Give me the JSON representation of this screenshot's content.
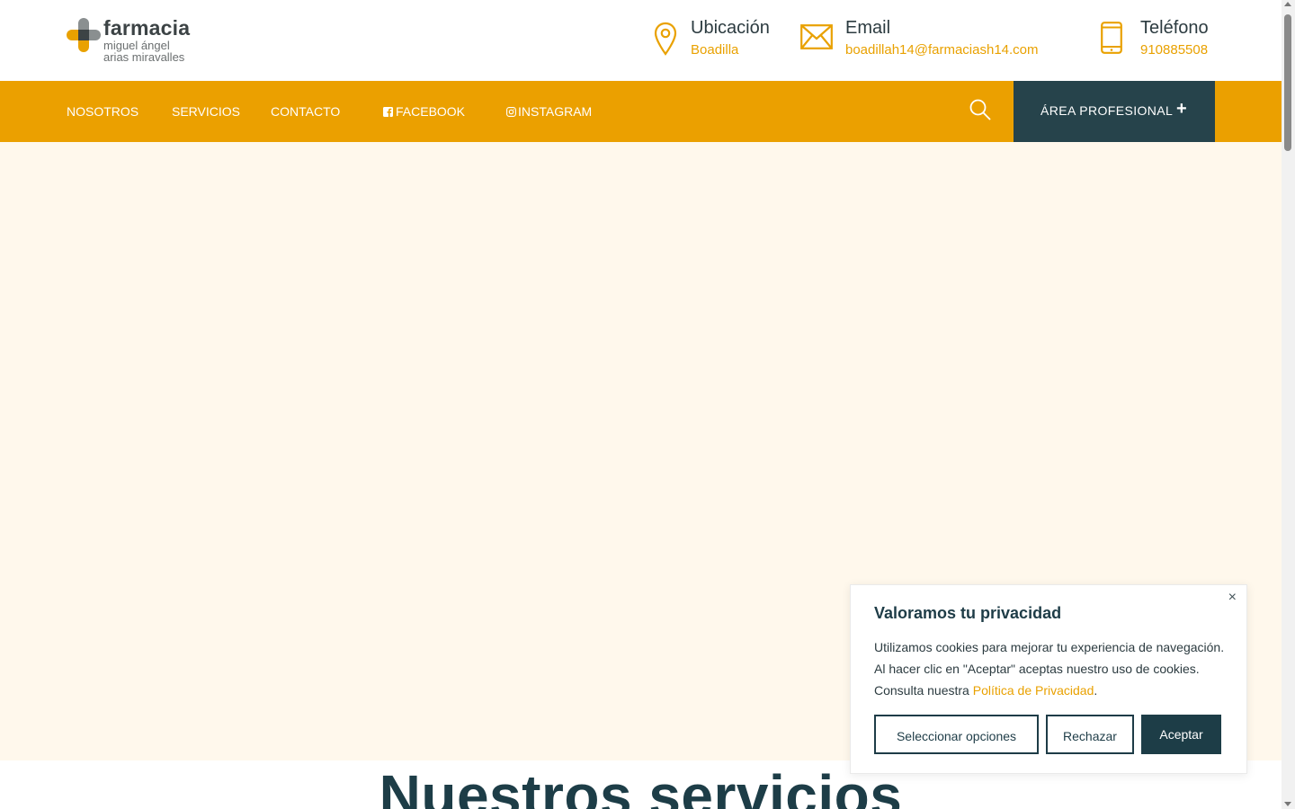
{
  "logo": {
    "main": "farmacia",
    "sub1": "miguel ángel",
    "sub2": "arias miravalles"
  },
  "contacts": [
    {
      "label": "Ubicación",
      "value": "Boadilla",
      "icon": "location-pin-icon"
    },
    {
      "label": "Email",
      "value": "boadillah14@farmaciash14.com",
      "icon": "envelope-icon"
    },
    {
      "label": "Teléfono",
      "value": "910885508",
      "icon": "phone-icon"
    }
  ],
  "nav": {
    "items": [
      {
        "label": "NOSOTROS"
      },
      {
        "label": "SERVICIOS"
      },
      {
        "label": "CONTACTO"
      },
      {
        "label": "FACEBOOK",
        "icon": "facebook-icon"
      },
      {
        "label": "INSTAGRAM",
        "icon": "instagram-icon"
      }
    ],
    "search_icon": "search-icon",
    "pro_button": {
      "label": "ÁREA PROFESIONAL",
      "icon": "plus-icon"
    }
  },
  "section": {
    "title": "Nuestros servicios"
  },
  "cookie": {
    "title": "Valoramos tu privacidad",
    "text": "Utilizamos cookies para mejorar tu experiencia de navegación. Al hacer clic en \"Aceptar\" aceptas nuestro uso de cookies. Consulta nuestra ",
    "link": "Política de Privacidad",
    "text_end": ".",
    "close": "×",
    "buttons": {
      "options": "Seleccionar opciones",
      "reject": "Rechazar",
      "accept": "Aceptar"
    }
  },
  "colors": {
    "accent": "#eba000",
    "dark": "#1d3d47",
    "hero_bg": "#fff8ec"
  }
}
